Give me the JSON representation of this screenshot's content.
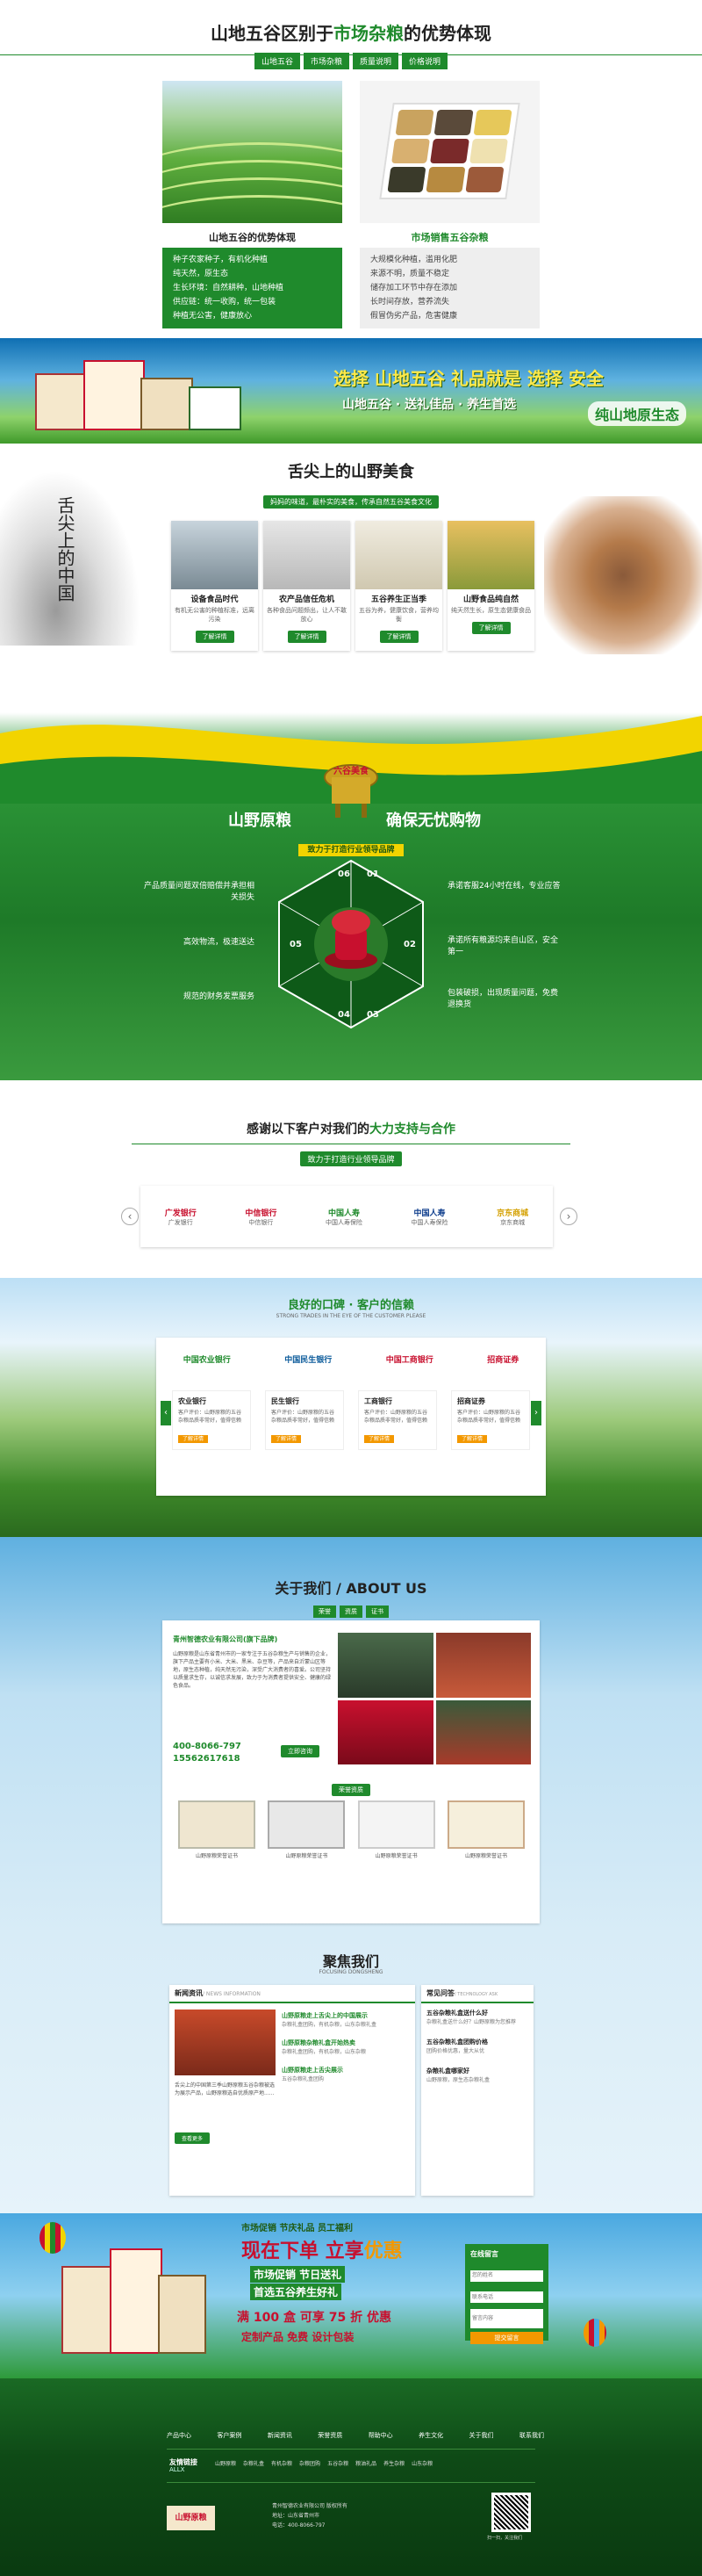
{
  "s1": {
    "title_pre": "山地五谷区别于",
    "title_hl": "市场杂粮",
    "title_post": "的优势体现",
    "tabs": [
      "山地五谷",
      "市场杂粮",
      "质量说明",
      "价格说明"
    ],
    "left_head": "山地五谷的优势体现",
    "right_head": "市场销售五谷杂粮",
    "left_items": [
      "种子农家种子，有机化种植",
      "纯天然，原生态",
      "生长环境：自然耕种，山地种植",
      "供应链：统一收购，统一包装",
      "种植无公害，健康放心"
    ],
    "right_items": [
      "大规模化种植，滥用化肥",
      "来源不明，质量不稳定",
      "储存加工环节中存在添加",
      "长时间存放，营养流失",
      "假冒伪劣产品，危害健康"
    ]
  },
  "banner1": {
    "line1": "选择 山地五谷 礼品就是 选择 安全",
    "line2": "山地五谷 · 送礼佳品 · 养生首选",
    "tag": "纯山地原生态"
  },
  "s3": {
    "calligraphy": "舌尖上的中国",
    "title": "舌尖上的山野美食",
    "sub": "妈妈的味道，最朴实的美食，传承自然五谷美食文化",
    "cards": [
      {
        "title": "设备食品时代",
        "desc": "有机无公害的种植标准，远离污染",
        "btn": "了解详情"
      },
      {
        "title": "农产品信任危机",
        "desc": "各种食品问题频出，让人不敢放心",
        "btn": "了解详情"
      },
      {
        "title": "五谷养生正当季",
        "desc": "五谷为养，健康饮食，营养均衡",
        "btn": "了解详情"
      },
      {
        "title": "山野食品纯自然",
        "desc": "纯天然生长，原生态健康食品",
        "btn": "了解详情"
      }
    ]
  },
  "s4": {
    "badge": "六谷美食",
    "title_left": "山野原粮",
    "title_right": "确保无忧购物",
    "sub": "致力于打造行业领导品牌",
    "nums": [
      "06",
      "01",
      "05",
      "02",
      "04",
      "03"
    ],
    "left_items": [
      "产品质量问题双倍赔偿并承担相关损失",
      "高效物流，极速送达",
      "规范的财务发票服务"
    ],
    "right_items": [
      "承诺客服24小时在线，专业应答",
      "承诺所有粮源均来自山区，安全第一",
      "包装破损，出现质量问题，免费退换货"
    ]
  },
  "s5": {
    "title_pre": "感谢以下客户对我们的",
    "title_hl": "大力支持与合作",
    "sub": "致力于打造行业领导品牌",
    "logos": [
      {
        "name": "广发银行",
        "cap": "广发银行"
      },
      {
        "name": "中信银行",
        "cap": "中信银行"
      },
      {
        "name": "中国人寿",
        "cap": "中国人寿保险"
      },
      {
        "name": "中国人寿",
        "cap": "中国人寿保险"
      },
      {
        "name": "京东商城",
        "cap": "京东商城"
      }
    ]
  },
  "s6": {
    "title": "良好的口碑 · 客户的信赖",
    "sub": "STRONG TRADES IN THE EYE OF THE CUSTOMER PLEASE",
    "logos": [
      "中国农业银行",
      "中国民生银行",
      "中国工商银行",
      "招商证券"
    ],
    "cards": [
      {
        "title": "农业银行",
        "desc": "客户评价：山野原粮的五谷杂粮品质非常好，值得信赖",
        "btn": "了解详情"
      },
      {
        "title": "民生银行",
        "desc": "客户评价：山野原粮的五谷杂粮品质非常好，值得信赖",
        "btn": "了解详情"
      },
      {
        "title": "工商银行",
        "desc": "客户评价：山野原粮的五谷杂粮品质非常好，值得信赖",
        "btn": "了解详情"
      },
      {
        "title": "招商证券",
        "desc": "客户评价：山野原粮的五谷杂粮品质非常好，值得信赖",
        "btn": "了解详情"
      }
    ]
  },
  "s7": {
    "title": "关于我们 / ABOUT US",
    "tabs": [
      "荣誉",
      "资质",
      "证书"
    ],
    "company": "青州智德农业有限公司(旗下品牌)",
    "body": "山野原粮是山东省青州市的一家专注于五谷杂粮生产与销售的企业，旗下产品主要有小米、大米、黑米、杂豆等，产品来自沂蒙山区等地，原生态种植，纯天然无污染，深受广大消费者的喜爱。公司坚持以质量求生存，以诚信求发展，致力于为消费者提供安全、健康的绿色食品。",
    "phone1": "400-8066-797",
    "phone2": "15562617618",
    "more": "立即咨询",
    "cert_head": "荣誉资质",
    "certs": [
      "山野原粮荣誉证书",
      "山野原粮荣誉证书",
      "山野原粮荣誉证书",
      "山野原粮荣誉证书"
    ]
  },
  "s8": {
    "title": "聚焦我们",
    "sub": "FOCUSING DONGSHENG",
    "news_head": "新闻资讯",
    "news_en": "/ NEWS INFORMATION",
    "faq_head": "常见问答",
    "faq_en": "/ TECHNOLOGY ASK",
    "news_items": [
      {
        "t": "山野原粮走上舌尖上的中国展示",
        "d": "杂粮礼盒团购，有机杂粮，山东杂粮礼盒"
      },
      {
        "t": "山野原粮杂粮礼盒开始热卖",
        "d": "杂粮礼盒团购，有机杂粮，山东杂粮"
      },
      {
        "t": "山野原粮走上舌尖展示",
        "d": "五谷杂粮礼盒团购"
      }
    ],
    "news_body": "舌尖上的中国第三季山野原粮五谷杂粮被选为展示产品，山野原粮选自优质原产地......",
    "more": "查看更多",
    "faq_items": [
      {
        "q": "五谷杂粮礼盒送什么好",
        "a": "杂粮礼盒送什么好？山野原粮为您推荐"
      },
      {
        "q": "五谷杂粮礼盒团购价格",
        "a": "团购价格优惠，量大从优"
      },
      {
        "q": "杂粮礼盒哪家好",
        "a": "山野原粮，原生态杂粮礼盒"
      }
    ]
  },
  "s9": {
    "top": "市场促销  节庆礼品  员工福利",
    "line1_pre": "现在下单 立享",
    "line1_hl": "优惠",
    "line2": "市场促销 节日送礼",
    "line3": "首选五谷养生好礼",
    "line4": "满 100 盒 可享 75 折 优惠",
    "line5": "定制产品 免费 设计包装",
    "form_title": "在线留言",
    "form_fields": [
      "您的姓名",
      "联系电话",
      "留言内容"
    ],
    "submit": "提交留言"
  },
  "footer": {
    "nav": [
      "产品中心",
      "客户案例",
      "新闻资讯",
      "荣誉资质",
      "帮助中心",
      "养生文化",
      "关于我们",
      "联系我们"
    ],
    "links_label": "友情链接",
    "links_sub": "ALLX",
    "links": [
      "山野原粮",
      "杂粮礼盒",
      "有机杂粮",
      "杂粮团购",
      "五谷杂粮",
      "粮油礼品",
      "养生杂粮",
      "山东杂粮"
    ],
    "logo": "山野原粮",
    "copy1": "青州智德农业有限公司 版权所有",
    "copy2": "地址：山东省青州市",
    "copy3": "电话：400-8066-797",
    "qr_label": "扫一扫，关注我们"
  },
  "colors": {
    "green": "#1f8a2c",
    "dark_green": "#15691f",
    "orange": "#f39800",
    "yellow": "#f2d400",
    "red": "#c8102e"
  }
}
